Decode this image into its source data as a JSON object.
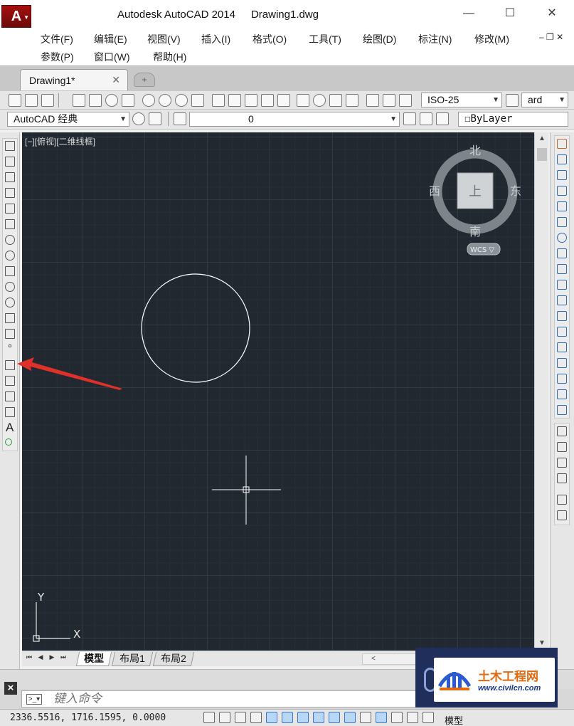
{
  "titlebar": {
    "app_title": "Autodesk AutoCAD 2014",
    "doc_title": "Drawing1.dwg",
    "minimize": "—",
    "maximize": "☐",
    "close": "✕"
  },
  "menu": {
    "row1": [
      "文件(F)",
      "编辑(E)",
      "视图(V)",
      "插入(I)",
      "格式(O)",
      "工具(T)",
      "绘图(D)",
      "标注(N)",
      "修改(M)"
    ],
    "row2": [
      "参数(P)",
      "窗口(W)",
      "帮助(H)"
    ]
  },
  "tabs": {
    "document": "Drawing1*",
    "close": "✕"
  },
  "toolbar": {
    "dim_style": "ISO-25",
    "text_style": "ard",
    "workspace": "AutoCAD 经典",
    "layer": "0",
    "linetype": "ByLayer"
  },
  "viewport": {
    "label": "[−][俯视][二维线框]"
  },
  "viewcube": {
    "north": "北",
    "south": "南",
    "east": "东",
    "west": "西",
    "face": "上",
    "wcs": "WCS ▽"
  },
  "ucs": {
    "x": "X",
    "y": "Y"
  },
  "layout_tabs": [
    "模型",
    "布局1",
    "布局2"
  ],
  "command": {
    "placeholder": "键入命令"
  },
  "status": {
    "coordinates": "2336.5516, 1716.1595, 0.0000",
    "model": "模型"
  },
  "watermark": {
    "name": "土木工程网",
    "url": "www.civilcn.com"
  },
  "colors": {
    "canvas_bg": "#212830",
    "annotation_arrow": "#e0302a",
    "app_red": "#a50f0f"
  }
}
